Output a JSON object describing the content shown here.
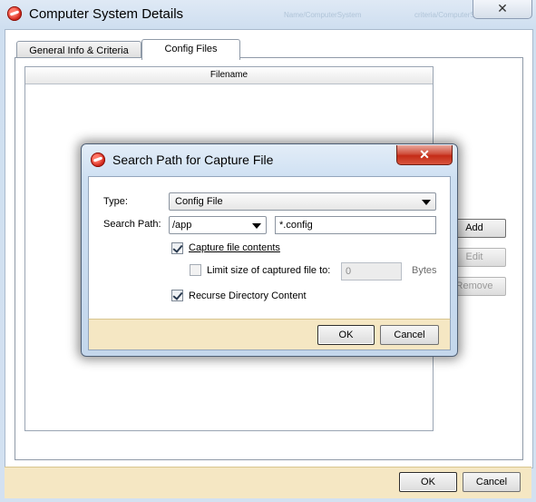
{
  "outer_window": {
    "title": "Computer System Details",
    "close_label": "✕",
    "ghost_text_1": "Name/ComputerSystem",
    "ghost_text_2": "criteria/ComputerSystem",
    "tabs": [
      {
        "label": "General Info & Criteria",
        "active": false
      },
      {
        "label": "Config Files",
        "active": true
      }
    ],
    "table": {
      "columns": [
        "Filename"
      ],
      "rows": []
    },
    "side_buttons": {
      "add": "Add",
      "edit": "Edit",
      "remove": "Remove"
    },
    "footer": {
      "ok": "OK",
      "cancel": "Cancel"
    }
  },
  "dialog": {
    "title": "Search Path for Capture File",
    "close_label": "✕",
    "type_label": "Type:",
    "type_value": "Config File",
    "search_path_label": "Search Path:",
    "search_path_value": "/app",
    "pattern_value": "*.config",
    "capture_contents_label": "Capture file contents",
    "capture_contents_checked": true,
    "limit_size_label": "Limit size of captured file to:",
    "limit_size_checked": false,
    "limit_size_value": "0",
    "limit_size_unit": "Bytes",
    "recurse_label": "Recurse Directory Content",
    "recurse_checked": true,
    "ok": "OK",
    "cancel": "Cancel"
  },
  "icons": {
    "app": "app-logo-icon",
    "close": "close-icon",
    "dropdown": "chevron-down-icon",
    "check": "checkmark-icon"
  },
  "colors": {
    "footer_bg": "#f5e7c3",
    "title_bar": "#cfdff0",
    "close_red": "#c42b17"
  }
}
